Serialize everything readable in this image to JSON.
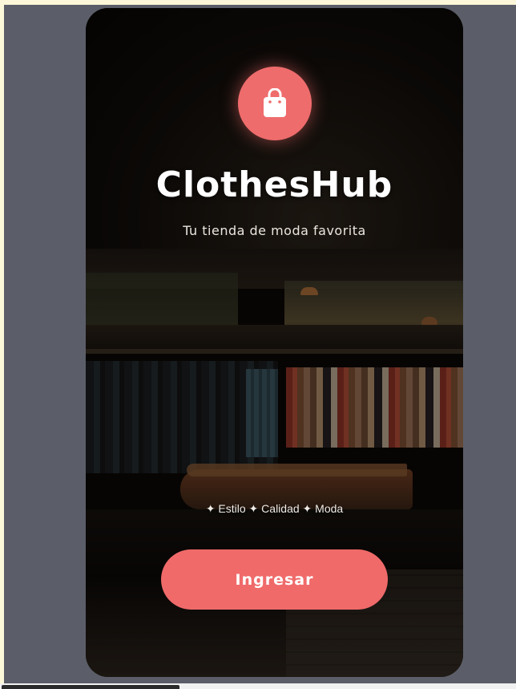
{
  "app": {
    "title": "ClothesHub",
    "subtitle": "Tu tienda de moda favorita",
    "tagline": "✦ Estilo ✦ Calidad ✦ Moda",
    "cta_label": "Ingresar",
    "logo_icon": "shopping-bag-icon"
  },
  "colors": {
    "accent": "#ef6c6c",
    "button": "#f06a6a",
    "text": "#ffffff",
    "backdrop": "#5b5e68"
  }
}
